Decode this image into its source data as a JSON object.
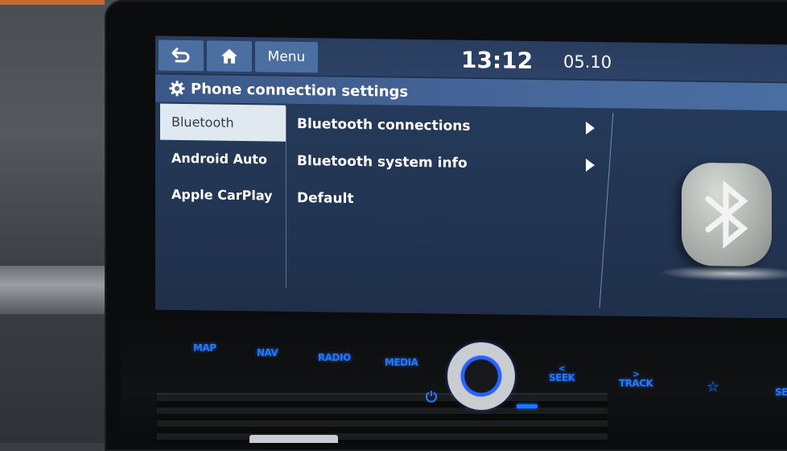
{
  "topbar": {
    "back_icon": "back-arrow-icon",
    "home_icon": "home-icon",
    "menu_label": "Menu",
    "time": "13:12",
    "date": "05.10"
  },
  "title": {
    "icon": "gear-icon",
    "text": "Phone connection settings"
  },
  "sidebar": {
    "items": [
      {
        "label": "Bluetooth",
        "active": true
      },
      {
        "label": "Android Auto",
        "active": false
      },
      {
        "label": "Apple CarPlay",
        "active": false
      }
    ]
  },
  "list": {
    "items": [
      {
        "label": "Bluetooth connections",
        "has_arrow": true
      },
      {
        "label": "Bluetooth system info",
        "has_arrow": true
      },
      {
        "label": "Default",
        "has_arrow": false
      }
    ]
  },
  "illustration": {
    "icon": "bluetooth-icon"
  },
  "hard_keys": {
    "map": "MAP",
    "nav": "NAV",
    "radio": "RADIO",
    "media": "MEDIA",
    "seek": "SEEK",
    "seek_symbol": "<",
    "track": "TRACK",
    "track_symbol": ">",
    "favorite_symbol": "☆",
    "setup_partial": "SE"
  },
  "colors": {
    "screen_bg": "#223350",
    "button_bg": "#4b6fa0",
    "title_bar": "#46679a",
    "active_item_bg": "#dfe9ef",
    "hardkey_blue": "#1f78ff"
  }
}
